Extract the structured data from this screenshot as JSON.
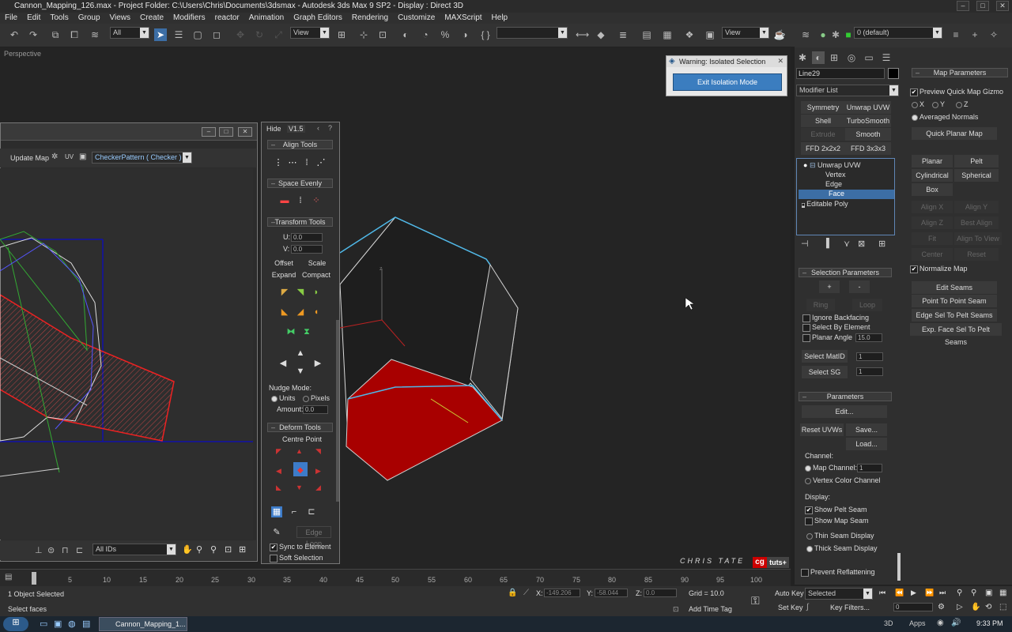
{
  "window": {
    "title": "Cannon_Mapping_126.max    - Project Folder: C:\\Users\\Chris\\Documents\\3dsmax    - Autodesk 3ds Max 9 SP2    - Display : Direct 3D"
  },
  "menu": [
    "File",
    "Edit",
    "Tools",
    "Group",
    "Views",
    "Create",
    "Modifiers",
    "reactor",
    "Animation",
    "Graph Editors",
    "Rendering",
    "Customize",
    "MAXScript",
    "Help"
  ],
  "toolbar": {
    "selection_filter": "All",
    "ref_coord": "View",
    "layer": "0 (default)",
    "view2": "View"
  },
  "viewport": {
    "label": "Perspective"
  },
  "warning": {
    "title": "Warning: Isolated Selection",
    "button": "Exit Isolation Mode"
  },
  "uv_editor": {
    "update_map": "Update Map",
    "uv_label": "UV",
    "texture": "CheckerPattern  ( Checker )",
    "ids": "All IDs"
  },
  "uv_panel": {
    "hide": "Hide",
    "version": "V1.5",
    "align_tools": "Align Tools",
    "space_evenly": "Space Evenly",
    "transform_tools": "Transform Tools",
    "u_label": "U:",
    "u_value": "0.0",
    "v_label": "V:",
    "v_value": "0.0",
    "offset": "Offset",
    "scale": "Scale",
    "expand": "Expand",
    "compact": "Compact",
    "nudge_mode": "Nudge Mode:",
    "units": "Units",
    "pixels": "Pixels",
    "amount_label": "Amount:",
    "amount_value": "0.0",
    "deform_tools": "Deform Tools",
    "centre_point": "Centre Point",
    "edge_loop": "Edge Loop",
    "sync": "Sync to Element",
    "soft": "Soft Selection"
  },
  "command_panel": {
    "object_name": "Line29",
    "modifier_list": "Modifier List",
    "mod_buttons": [
      "Symmetry",
      "Unwrap UVW",
      "Shell",
      "TurboSmooth",
      "Extrude",
      "Smooth",
      "FFD 2x2x2",
      "FFD 3x3x3"
    ],
    "stack": [
      "Unwrap UVW",
      "Vertex",
      "Edge",
      "Face",
      "Editable Poly"
    ],
    "selection_params": "Selection Parameters",
    "sel_plus": "+",
    "sel_minus": "-",
    "ring": "Ring",
    "loop": "Loop",
    "ignore_backfacing": "Ignore Backfacing",
    "select_by_element": "Select By Element",
    "planar_angle": "Planar Angle",
    "planar_value": "15.0",
    "select_matid": "Select MatID",
    "select_sg": "Select SG",
    "matid_value": "1",
    "sg_value": "1",
    "parameters": "Parameters",
    "edit": "Edit...",
    "reset_uvws": "Reset UVWs",
    "save": "Save...",
    "load": "Load...",
    "channel": "Channel:",
    "map_channel": "Map Channel:",
    "map_channel_value": "1",
    "vertex_color_channel": "Vertex Color Channel",
    "display": "Display:",
    "show_pelt_seam": "Show Pelt Seam",
    "show_map_seam": "Show Map Seam",
    "thin_seam": "Thin Seam Display",
    "thick_seam": "Thick Seam Display",
    "prevent_reflattening": "Prevent Reflattening"
  },
  "map_params": {
    "title": "Map Parameters",
    "preview_gizmo": "Preview Quick Map Gizmo",
    "x": "X",
    "y": "Y",
    "z": "Z",
    "averaged_normals": "Averaged Normals",
    "quick_planar": "Quick Planar Map",
    "planar": "Planar",
    "pelt": "Pelt",
    "cylindrical": "Cylindrical",
    "spherical": "Spherical",
    "box": "Box",
    "align_x": "Align X",
    "align_y": "Align Y",
    "align_z": "Align Z",
    "best_align": "Best Align",
    "fit": "Fit",
    "align_to_view": "Align To View",
    "center": "Center",
    "reset": "Reset",
    "normalize_map": "Normalize Map",
    "edit_seams": "Edit Seams",
    "point_to_point": "Point To Point Seam",
    "edge_sel_to_pelt": "Edge Sel To Pelt Seams",
    "exp_face_sel": "Exp. Face Sel To Pelt Seams"
  },
  "timeline": {
    "ticks": [
      "5",
      "10",
      "15",
      "20",
      "25",
      "30",
      "35",
      "40",
      "45",
      "50",
      "55",
      "60",
      "65",
      "70",
      "75",
      "80",
      "85",
      "90",
      "95",
      "100"
    ],
    "frame": "0 / 100"
  },
  "status": {
    "selected": "1 Object Selected",
    "prompt": "Select faces",
    "x_label": "X:",
    "x_value": "-149.206",
    "y_label": "Y:",
    "y_value": "-58.044",
    "z_label": "Z:",
    "z_value": "0.0",
    "grid": "Grid = 10.0",
    "add_time_tag": "Add Time Tag",
    "auto_key": "Auto Key",
    "set_key": "Set Key",
    "key_mode": "Selected",
    "key_filters": "Key Filters...",
    "frame_field": "0"
  },
  "watermark": {
    "author": "CHRIS TATE",
    "cg": "cg",
    "tuts": "tuts+"
  },
  "taskbar": {
    "task": "Cannon_Mapping_1...",
    "dd": "3D",
    "apps": "Apps",
    "time": "9:33 PM"
  }
}
